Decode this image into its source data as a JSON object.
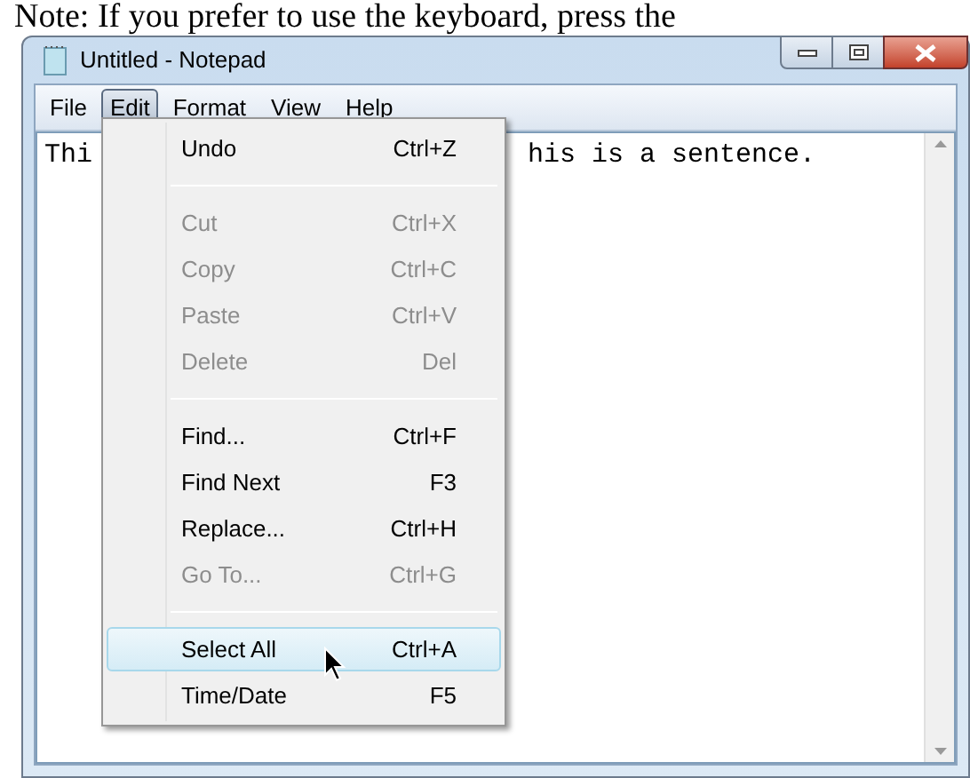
{
  "caption": "Note:  If you prefer to use the keyboard, press the",
  "window": {
    "title": "Untitled - Notepad"
  },
  "menubar": [
    {
      "label": "File",
      "selected": false
    },
    {
      "label": "Edit",
      "selected": true
    },
    {
      "label": "Format",
      "selected": false
    },
    {
      "label": "View",
      "selected": false
    },
    {
      "label": "Help",
      "selected": false
    }
  ],
  "editor": {
    "text_left": "Thi",
    "text_right": "his is a sentence."
  },
  "edit_menu": [
    {
      "kind": "item",
      "label": "Undo",
      "shortcut": "Ctrl+Z",
      "disabled": false,
      "selected": false
    },
    {
      "kind": "separator"
    },
    {
      "kind": "item",
      "label": "Cut",
      "shortcut": "Ctrl+X",
      "disabled": true,
      "selected": false
    },
    {
      "kind": "item",
      "label": "Copy",
      "shortcut": "Ctrl+C",
      "disabled": true,
      "selected": false
    },
    {
      "kind": "item",
      "label": "Paste",
      "shortcut": "Ctrl+V",
      "disabled": true,
      "selected": false
    },
    {
      "kind": "item",
      "label": "Delete",
      "shortcut": "Del",
      "disabled": true,
      "selected": false
    },
    {
      "kind": "separator"
    },
    {
      "kind": "item",
      "label": "Find...",
      "shortcut": "Ctrl+F",
      "disabled": false,
      "selected": false
    },
    {
      "kind": "item",
      "label": "Find Next",
      "shortcut": "F3",
      "disabled": false,
      "selected": false
    },
    {
      "kind": "item",
      "label": "Replace...",
      "shortcut": "Ctrl+H",
      "disabled": false,
      "selected": false
    },
    {
      "kind": "item",
      "label": "Go To...",
      "shortcut": "Ctrl+G",
      "disabled": true,
      "selected": false
    },
    {
      "kind": "separator"
    },
    {
      "kind": "item",
      "label": "Select All",
      "shortcut": "Ctrl+A",
      "disabled": false,
      "selected": true
    },
    {
      "kind": "item",
      "label": "Time/Date",
      "shortcut": "F5",
      "disabled": false,
      "selected": false
    }
  ]
}
